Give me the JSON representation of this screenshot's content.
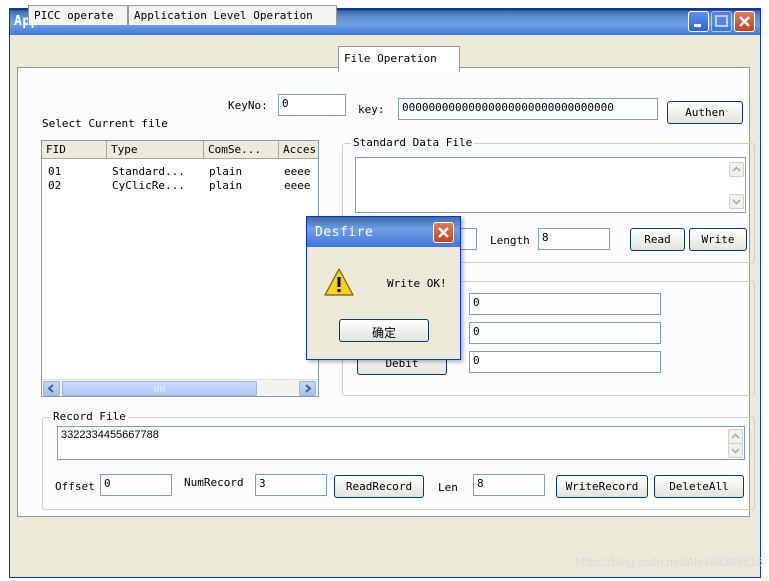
{
  "window": {
    "title": "Application Demo"
  },
  "tabs": [
    {
      "label": "PICC operate"
    },
    {
      "label": "Application Level Operation"
    },
    {
      "label": "File Operation"
    }
  ],
  "file_select": {
    "label": "Select Current file",
    "keyno_label": "KeyNo:",
    "keyno_value": "0",
    "key_label": "key:",
    "key_value": "00000000000000000000000000000000",
    "authen_label": "Authen"
  },
  "file_list": {
    "columns": [
      "FID",
      "Type",
      "ComSe...",
      "Acces"
    ],
    "rows": [
      [
        "01",
        "Standard...",
        "plain",
        "eeee"
      ],
      [
        "02",
        "CyClicRe...",
        "plain",
        "eeee"
      ]
    ]
  },
  "standard_data": {
    "group_label": "Standard Data File",
    "content": "",
    "length_label": "Length",
    "length_value": "8",
    "read_label": "Read",
    "write_label": "Write"
  },
  "value_file": {
    "field1_value": "0",
    "field2_value": "0",
    "debit_label": "Debit",
    "debit_value": "0"
  },
  "record_file": {
    "group_label": "Record File",
    "content": "3322334455667788",
    "offset_label": "Offset",
    "offset_value": "0",
    "numrecord_label": "NumRecord",
    "numrecord_value": "3",
    "readrecord_label": "ReadRecord",
    "len_label": "Len",
    "len_value": "8",
    "writerecord_label": "WriteRecord",
    "deleteall_label": "DeleteAll"
  },
  "dialog": {
    "title": "Desfire",
    "message": "Write OK!",
    "ok_label": "确定"
  },
  "watermark": "https://blog.csdn.net/Alex88389516",
  "colors": {
    "titlebar": "#3c77d8",
    "window_bg": "#ece9d8",
    "panel_bg": "#fcfcfe",
    "warning": "#f5d21c"
  }
}
